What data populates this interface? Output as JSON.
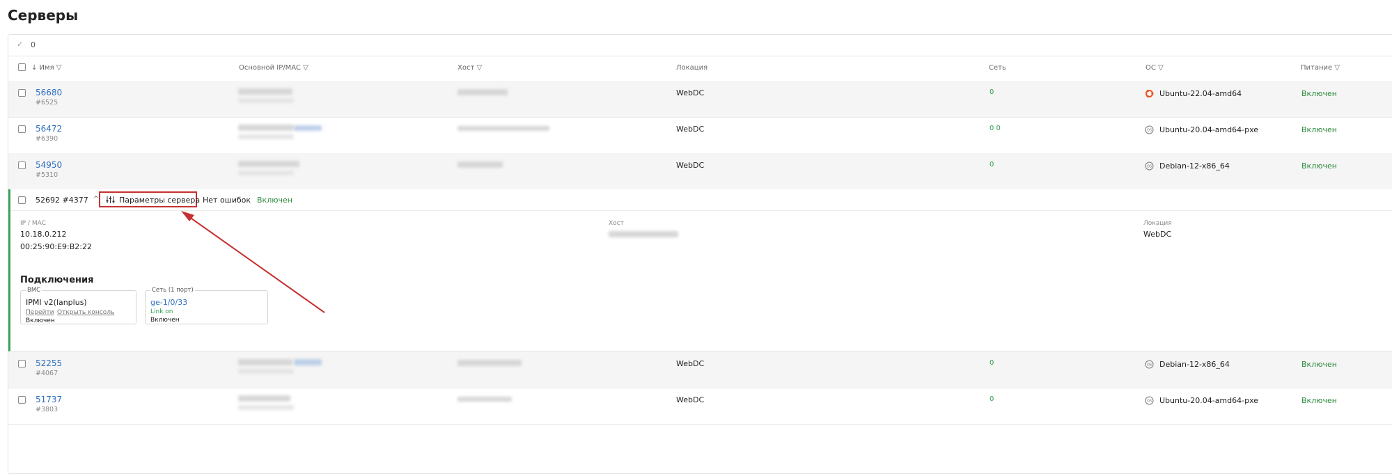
{
  "page_title": "Серверы",
  "selection_count": "0",
  "columns": {
    "name": "↓ Имя",
    "ip": "Основной IP/MAC",
    "host": "Хост",
    "location": "Локация",
    "network": "Сеть",
    "os": "ОС",
    "power": "Питание"
  },
  "rows_top": [
    {
      "name": "56680",
      "sub": "#6525",
      "location": "WebDC",
      "network": "0",
      "os": "Ubuntu-22.04-amd64",
      "os_icon": "ubuntu-icon",
      "power": "Включен"
    },
    {
      "name": "56472",
      "sub": "#6390",
      "location": "WebDC",
      "network": "0 0",
      "os": "Ubuntu-20.04-amd64-pxe",
      "os_icon": "os-generic-icon",
      "power": "Включен"
    },
    {
      "name": "54950",
      "sub": "#5310",
      "location": "WebDC",
      "network": "0",
      "os": "Debian-12-x86_64",
      "os_icon": "os-generic-icon",
      "power": "Включен"
    }
  ],
  "expanded": {
    "title": "52692 #4377",
    "params_button": "Параметры сервера",
    "errors": "Нет ошибок",
    "power": "Включен",
    "ip_mac_label": "IP / MAC",
    "ip": "10.18.0.212",
    "mac": "00:25:90:E9:B2:22",
    "host_label": "Хост",
    "location_label": "Локация",
    "location": "WebDC",
    "connections_title": "Подключения",
    "bmc": {
      "legend": "BMC",
      "type": "IPMI v2(lanplus)",
      "goto_link": "Перейти",
      "console_link": "Открыть консоль",
      "status": "Включен"
    },
    "net": {
      "legend": "Сеть (1 порт)",
      "port": "ge-1/0/33",
      "link": "Link on",
      "status": "Включен"
    }
  },
  "rows_bottom": [
    {
      "name": "52255",
      "sub": "#4067",
      "location": "WebDC",
      "network": "0",
      "os": "Debian-12-x86_64",
      "os_icon": "os-generic-icon",
      "power": "Включен"
    },
    {
      "name": "51737",
      "sub": "#3803",
      "location": "WebDC",
      "network": "0",
      "os": "Ubuntu-20.04-amd64-pxe",
      "os_icon": "os-generic-icon",
      "power": "Включен"
    }
  ],
  "colors": {
    "link": "#2f6fbf",
    "success": "#2e8a3e",
    "highlight": "#c53131",
    "expanded_border": "#3aa35a"
  }
}
